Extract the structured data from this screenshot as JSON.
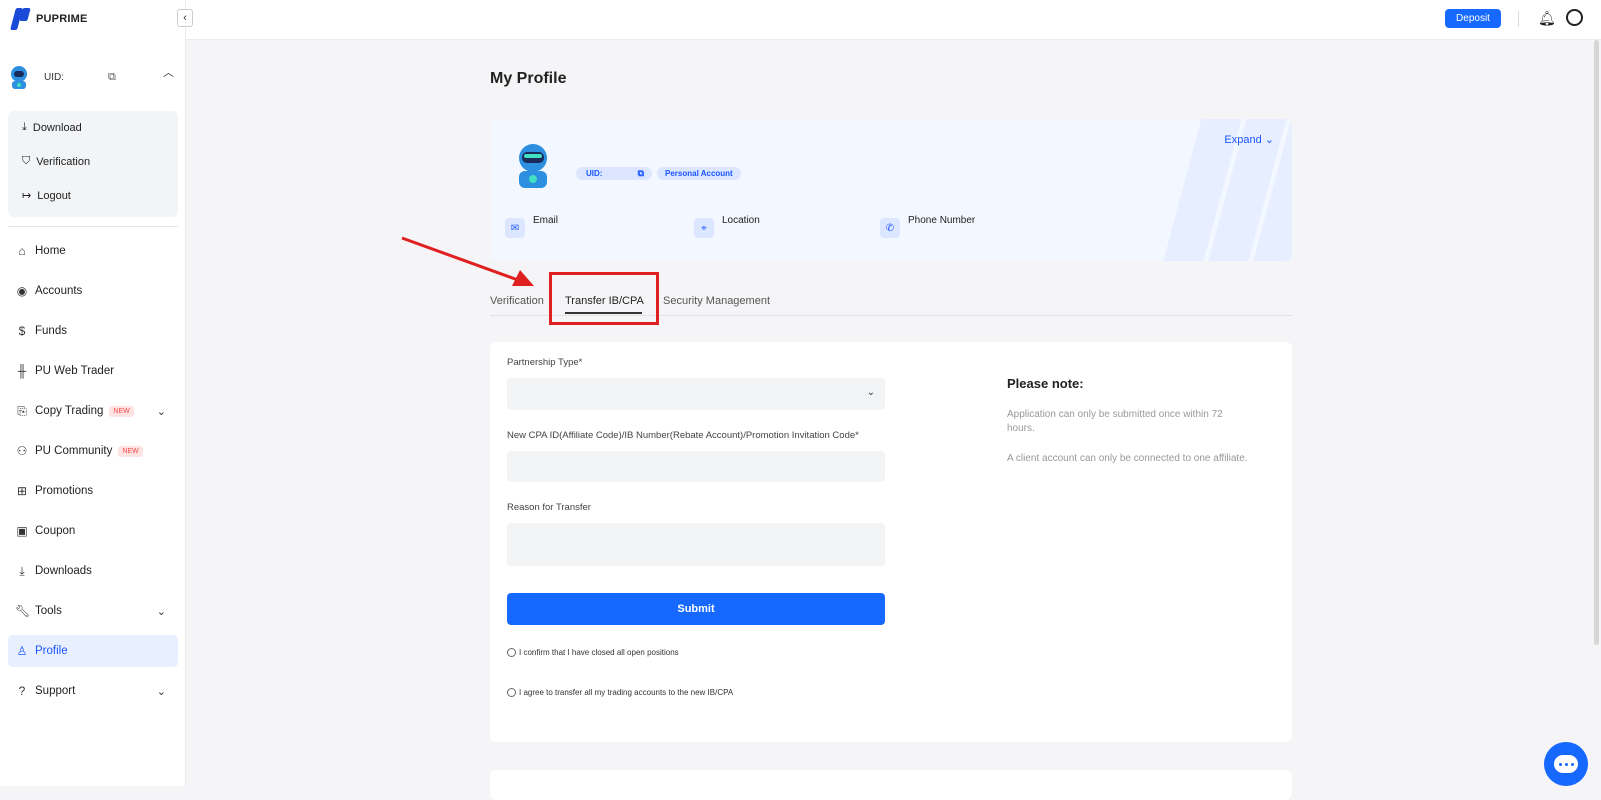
{
  "brand": {
    "name": "PUPRIME"
  },
  "sidebar": {
    "uid_label": "UID:",
    "user_menu": [
      {
        "label": "Download",
        "icon": "download-icon"
      },
      {
        "label": "Verification",
        "icon": "shield-icon"
      },
      {
        "label": "Logout",
        "icon": "logout-icon"
      }
    ],
    "nav": [
      {
        "label": "Home",
        "icon": "home-icon"
      },
      {
        "label": "Accounts",
        "icon": "user-circle-icon"
      },
      {
        "label": "Funds",
        "icon": "dollar-icon"
      },
      {
        "label": "PU Web Trader",
        "icon": "candlestick-icon"
      },
      {
        "label": "Copy Trading",
        "icon": "copy-trading-icon",
        "badge": "NEW",
        "expandable": true
      },
      {
        "label": "PU Community",
        "icon": "community-icon",
        "badge": "NEW"
      },
      {
        "label": "Promotions",
        "icon": "gift-icon"
      },
      {
        "label": "Coupon",
        "icon": "coupon-icon"
      },
      {
        "label": "Downloads",
        "icon": "download-icon"
      },
      {
        "label": "Tools",
        "icon": "wrench-icon",
        "expandable": true
      },
      {
        "label": "Profile",
        "icon": "person-icon",
        "active": true
      },
      {
        "label": "Support",
        "icon": "question-icon",
        "expandable": true
      }
    ]
  },
  "topbar": {
    "deposit_label": "Deposit"
  },
  "page": {
    "title": "My Profile"
  },
  "profile_card": {
    "expand_label": "Expand",
    "uid_label": "UID:",
    "account_type": "Personal Account",
    "email_label": "Email",
    "location_label": "Location",
    "phone_label": "Phone Number"
  },
  "tabs": [
    {
      "label": "Verification"
    },
    {
      "label": "Transfer IB/CPA",
      "active": true
    },
    {
      "label": "Security Management"
    }
  ],
  "form": {
    "partnership_label": "Partnership Type*",
    "code_label": "New CPA ID(Affiliate Code)/IB Number(Rebate Account)/Promotion Invitation Code*",
    "reason_label": "Reason for Transfer",
    "submit_label": "Submit",
    "confirm_positions": "I confirm that I have closed all open positions",
    "agree_transfer": "I agree to transfer all my trading accounts to the new IB/CPA"
  },
  "note": {
    "title": "Please note:",
    "line1": "Application can only be submitted once within 72 hours.",
    "line2": "A client account can only be connected to one affiliate."
  },
  "colors": {
    "accent": "#1668ff",
    "annotation": "#e02020"
  }
}
